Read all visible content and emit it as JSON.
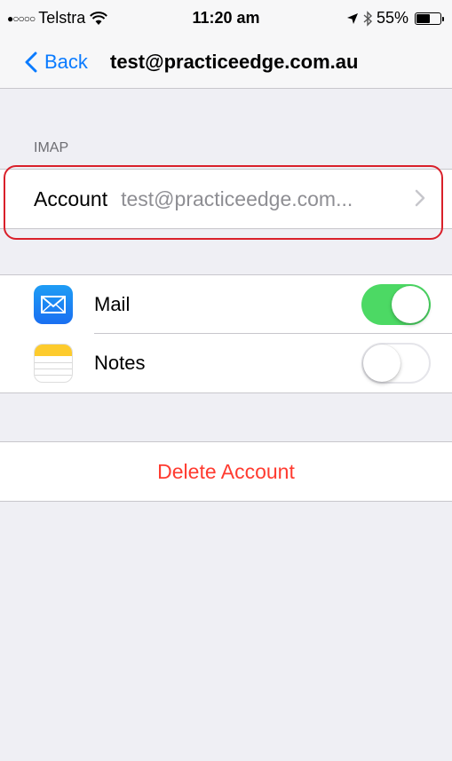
{
  "status_bar": {
    "signal_dots": "●○○○○",
    "carrier": "Telstra",
    "wifi_icon": "wifi-icon",
    "time": "11:20 am",
    "location_icon": "location-arrow-icon",
    "bluetooth_icon": "bluetooth-icon",
    "battery_percent": "55%",
    "battery_level": 0.55
  },
  "navbar": {
    "back_label": "Back",
    "title": "test@practiceedge.com.au"
  },
  "imap_section": {
    "header": "IMAP",
    "account_label": "Account",
    "account_value": "test@practiceedge.com..."
  },
  "apps": [
    {
      "label": "Mail",
      "icon": "mail-app-icon",
      "enabled": true
    },
    {
      "label": "Notes",
      "icon": "notes-app-icon",
      "enabled": false
    }
  ],
  "delete_account_label": "Delete Account",
  "colors": {
    "accent": "#0a7bff",
    "toggle_on": "#4cd964",
    "destructive": "#ff3b30",
    "highlight": "#d9202a"
  }
}
